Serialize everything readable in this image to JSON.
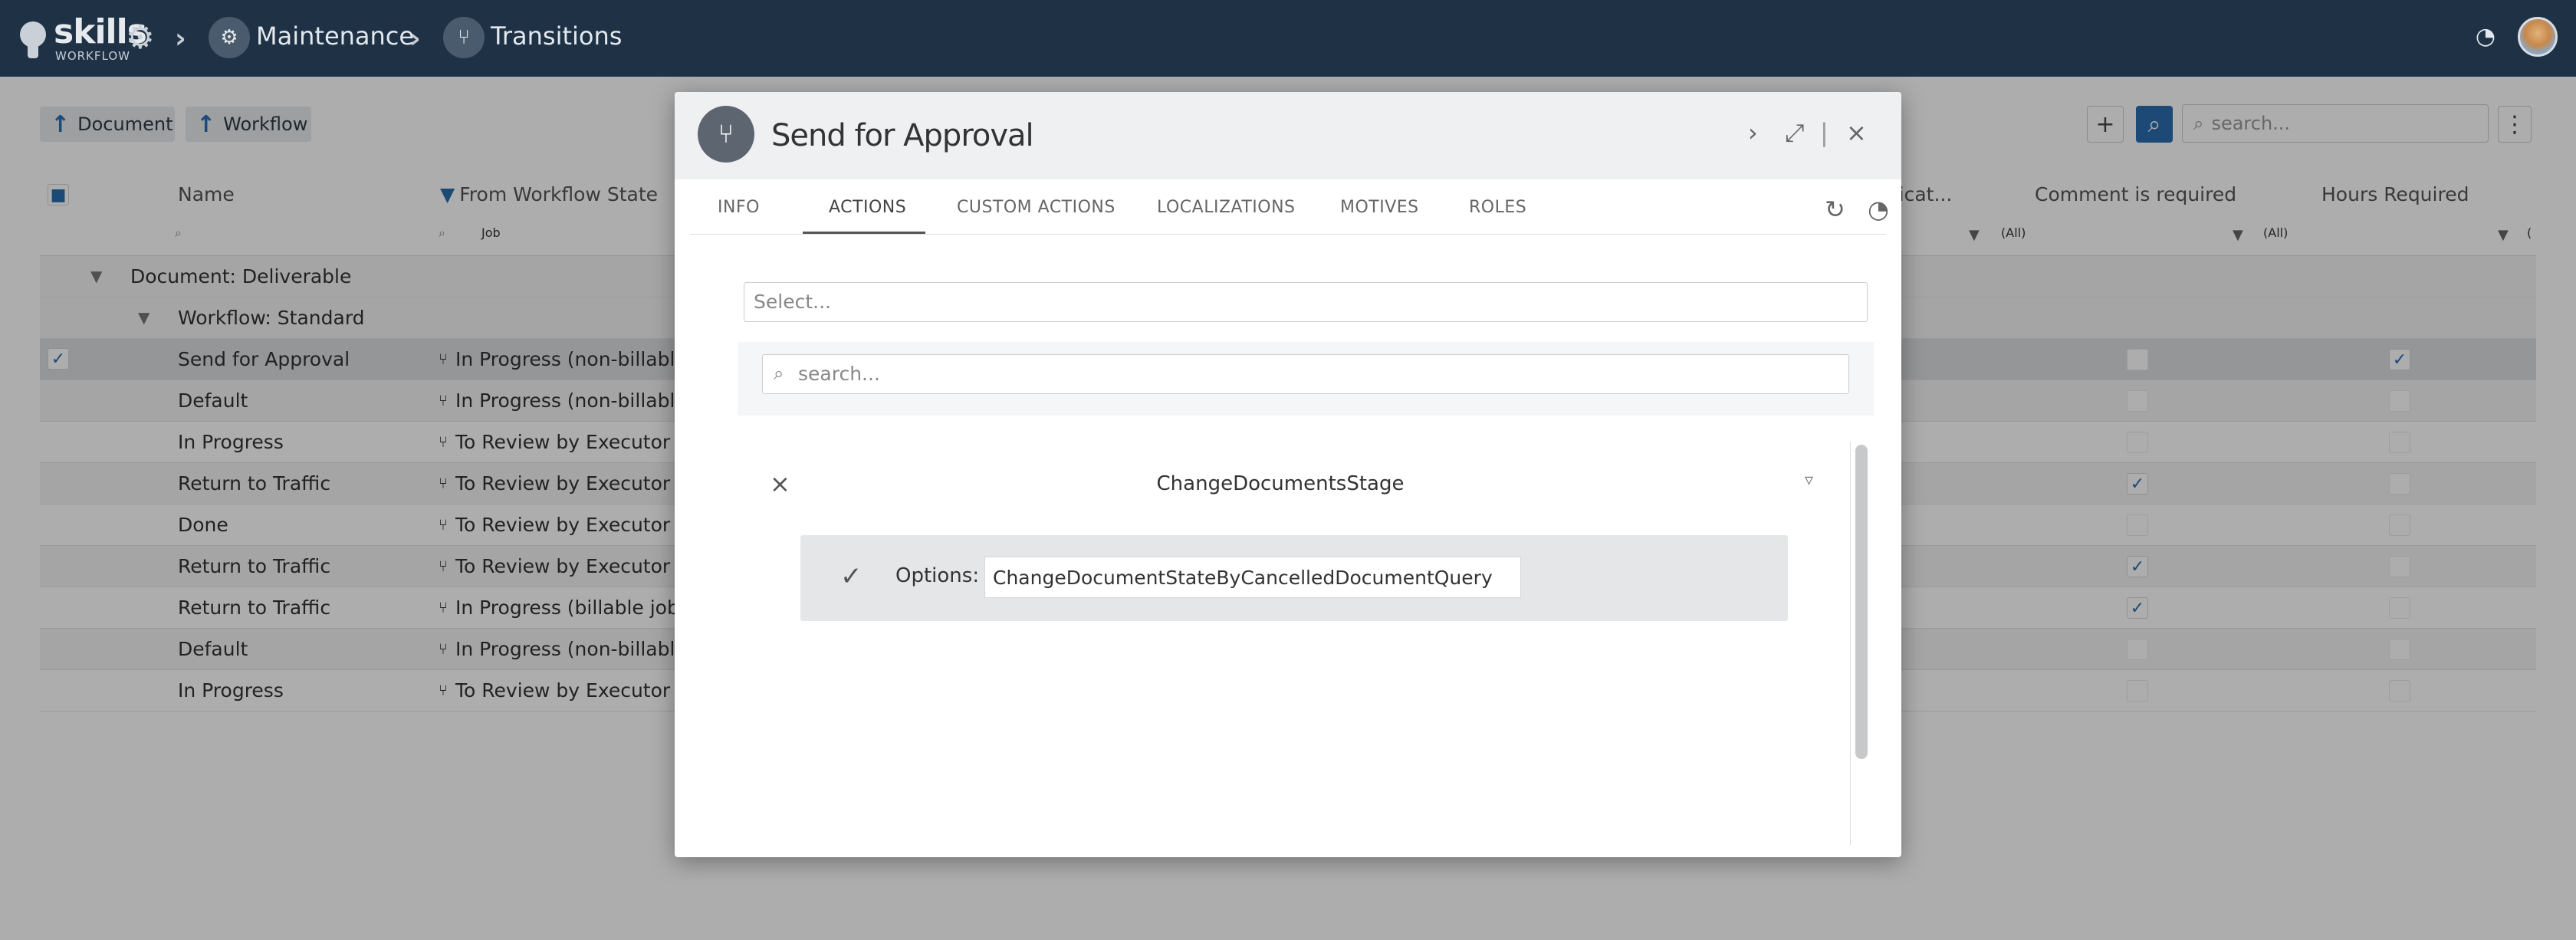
{
  "topbar": {
    "logo_word": "skills",
    "logo_sub": "WORKFLOW",
    "crumbs": [
      "Maintenance",
      "Transitions"
    ]
  },
  "toolbar": {
    "nav_buttons": [
      "Document",
      "Workflow"
    ],
    "search_placeholder": "search..."
  },
  "grid": {
    "headers": {
      "name": "Name",
      "from_state": "From Workflow State",
      "notification": "...ficat...",
      "comment_required": "Comment is required",
      "hours_required": "Hours Required"
    },
    "filters": {
      "from_state": "Job",
      "notification": "",
      "comment_required": "(All)",
      "hours_required": "(All)",
      "extra": "("
    },
    "groups": {
      "document": "Document: Deliverable",
      "workflow": "Workflow: Standard"
    },
    "rows": [
      {
        "name": "Send for Approval",
        "from": "In Progress (non-billable j",
        "comment": false,
        "hours": true
      },
      {
        "name": "Default",
        "from": "In Progress (non-billable j",
        "comment": false,
        "hours": false
      },
      {
        "name": "In Progress",
        "from": "To Review by Executor (b",
        "comment": false,
        "hours": false
      },
      {
        "name": "Return to Traffic",
        "from": "To Review by Executor (b",
        "comment": true,
        "hours": false
      },
      {
        "name": "Done",
        "from": "To Review by Executor (b",
        "comment": false,
        "hours": false
      },
      {
        "name": "Return to Traffic",
        "from": "To Review by Executor (n",
        "comment": true,
        "hours": false
      },
      {
        "name": "Return to Traffic",
        "from": " In Progress (billable job)",
        "comment": true,
        "hours": false
      },
      {
        "name": "Default",
        "from": "In Progress (non-billable j",
        "comment": false,
        "hours": false
      },
      {
        "name": "In Progress",
        "from": "To Review by Executor (n",
        "comment": false,
        "hours": false
      }
    ]
  },
  "dialog": {
    "title": "Send for Approval",
    "tabs": [
      "INFO",
      "ACTIONS",
      "CUSTOM ACTIONS",
      "LOCALIZATIONS",
      "MOTIVES",
      "ROLES"
    ],
    "active_tab": "ACTIONS",
    "select_placeholder": "Select...",
    "search_placeholder": "search...",
    "action": {
      "name": "ChangeDocumentsStage",
      "options_label": "Options:",
      "options_value": "ChangeDocumentStateByCancelledDocumentQuery"
    }
  },
  "colors": {
    "topbar": "#1e3145",
    "accent": "#2b6cb0",
    "selected_row": "#dcdde0"
  }
}
